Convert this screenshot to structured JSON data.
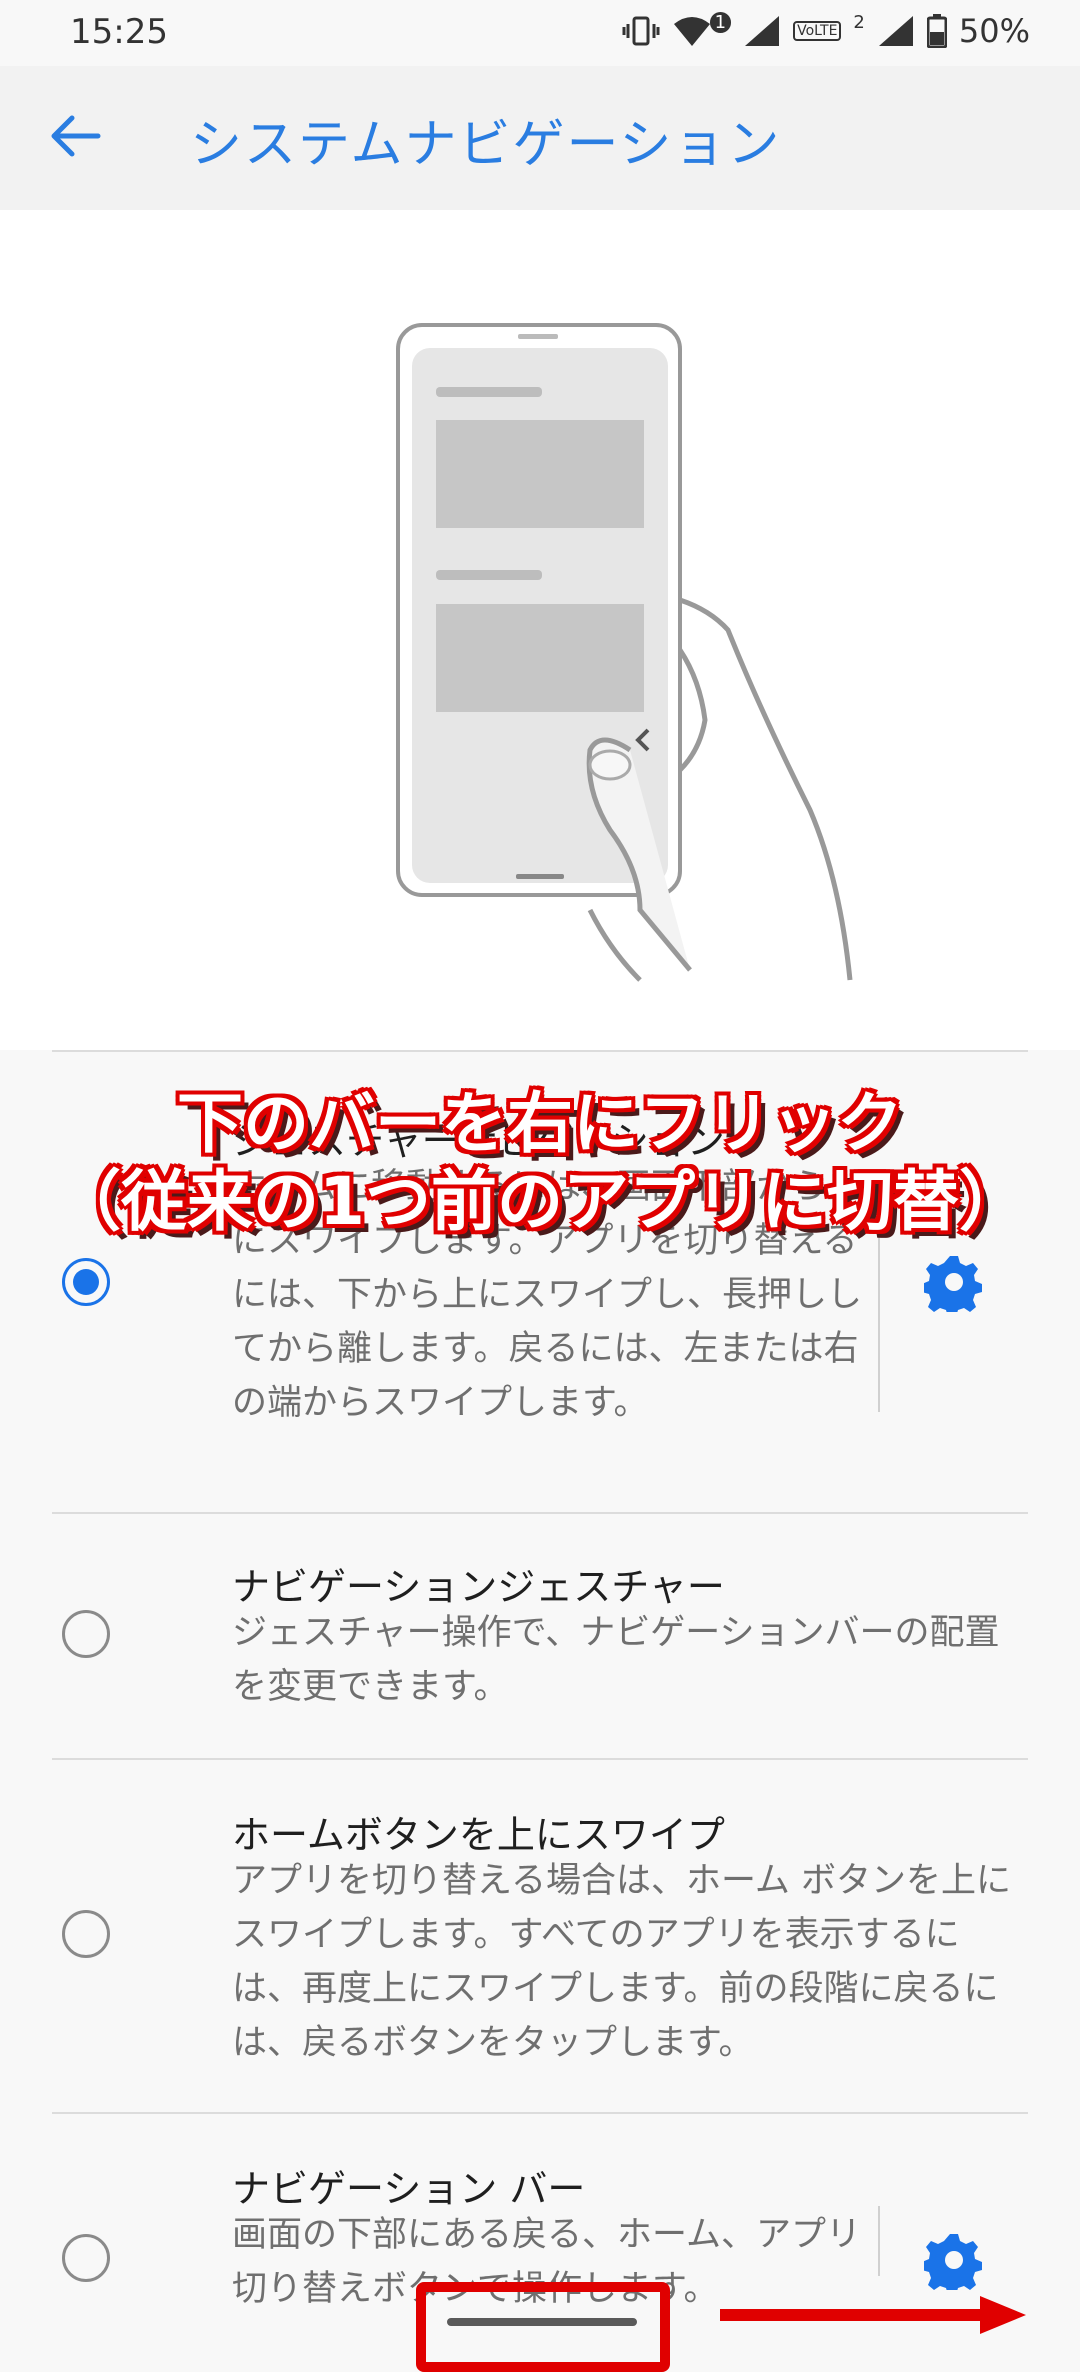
{
  "status": {
    "time": "15:25",
    "sim1_badge": "1",
    "volte_label": "VoLTE",
    "sim2_badge": "2",
    "battery": "50%"
  },
  "appbar": {
    "title": "システムナビゲーション"
  },
  "options": [
    {
      "title": "ジェスチャーナビゲーション",
      "desc": "ホームに移動するには、画面下部から上にスワイプします。アプリを切り替えるには、下から上にスワイプし、長押ししてから離します。戻るには、左または右の端からスワイプします。",
      "selected": true
    },
    {
      "title": "ナビゲーションジェスチャー",
      "desc": "ジェスチャー操作で、ナビゲーションバーの配置を変更できます。",
      "selected": false
    },
    {
      "title": "ホームボタンを上にスワイプ",
      "desc": "アプリを切り替える場合は、ホーム ボタンを上にスワイプします。すべてのアプリを表示するには、再度上にスワイプします。前の段階に戻るには、戻るボタンをタップします。",
      "selected": false
    },
    {
      "title": "ナビゲーション バー",
      "desc": "画面の下部にある戻る、ホーム、アプリ切り替えボタンで操作します。",
      "selected": false
    }
  ],
  "overlay": {
    "line1": "下のバーを右にフリック",
    "line2": "（従来の1つ前のアプリに切替）"
  },
  "colors": {
    "accent": "#1a73e8",
    "title": "#2a7de1",
    "annotation": "#e00000"
  }
}
